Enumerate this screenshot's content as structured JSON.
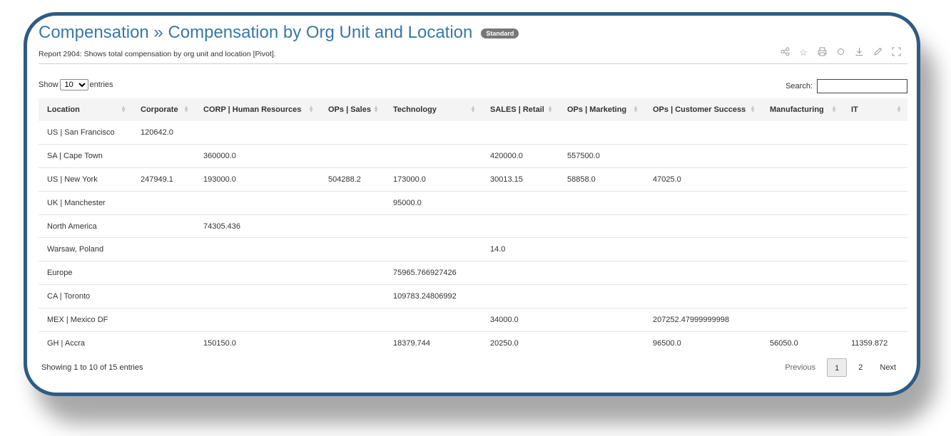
{
  "header": {
    "title": "Compensation » Compensation by Org Unit and Location",
    "badge": "Standard",
    "subtitle": "Report  2904: Shows total compensation by org unit and location [Pivot]."
  },
  "toolbar_icons": [
    "share-icon",
    "star-icon",
    "print-icon",
    "refresh-icon",
    "download-icon",
    "edit-icon",
    "fullscreen-icon"
  ],
  "controls": {
    "show_label": "Show",
    "page_size": "10",
    "entries_label": "entries",
    "search_label": "Search:",
    "search_value": ""
  },
  "table": {
    "columns": [
      "Location",
      "Corporate",
      "CORP | Human Resources",
      "OPs | Sales",
      "Technology",
      "SALES | Retail",
      "OPs | Marketing",
      "OPs | Customer Success",
      "Manufacturing",
      "IT"
    ],
    "rows": [
      [
        "US | San Francisco",
        "120642.0",
        "",
        "",
        "",
        "",
        "",
        "",
        "",
        ""
      ],
      [
        "SA | Cape Town",
        "",
        "360000.0",
        "",
        "",
        "420000.0",
        "557500.0",
        "",
        "",
        ""
      ],
      [
        "US | New York",
        "247949.1",
        "193000.0",
        "504288.2",
        "173000.0",
        "30013.15",
        "58858.0",
        "47025.0",
        "",
        ""
      ],
      [
        "UK | Manchester",
        "",
        "",
        "",
        "95000.0",
        "",
        "",
        "",
        "",
        ""
      ],
      [
        "North America",
        "",
        "74305.436",
        "",
        "",
        "",
        "",
        "",
        "",
        ""
      ],
      [
        "Warsaw, Poland",
        "",
        "",
        "",
        "",
        "14.0",
        "",
        "",
        "",
        ""
      ],
      [
        "Europe",
        "",
        "",
        "",
        "75965.766927426",
        "",
        "",
        "",
        "",
        ""
      ],
      [
        "CA | Toronto",
        "",
        "",
        "",
        "109783.24806992",
        "",
        "",
        "",
        "",
        ""
      ],
      [
        "MEX | Mexico DF",
        "",
        "",
        "",
        "",
        "34000.0",
        "",
        "207252.47999999998",
        "",
        ""
      ],
      [
        "GH | Accra",
        "",
        "150150.0",
        "",
        "18379.744",
        "20250.0",
        "",
        "96500.0",
        "56050.0",
        "11359.872"
      ]
    ]
  },
  "footer": {
    "info": "Showing 1 to 10 of 15 entries",
    "previous": "Previous",
    "pages": [
      "1",
      "2"
    ],
    "next": "Next"
  }
}
